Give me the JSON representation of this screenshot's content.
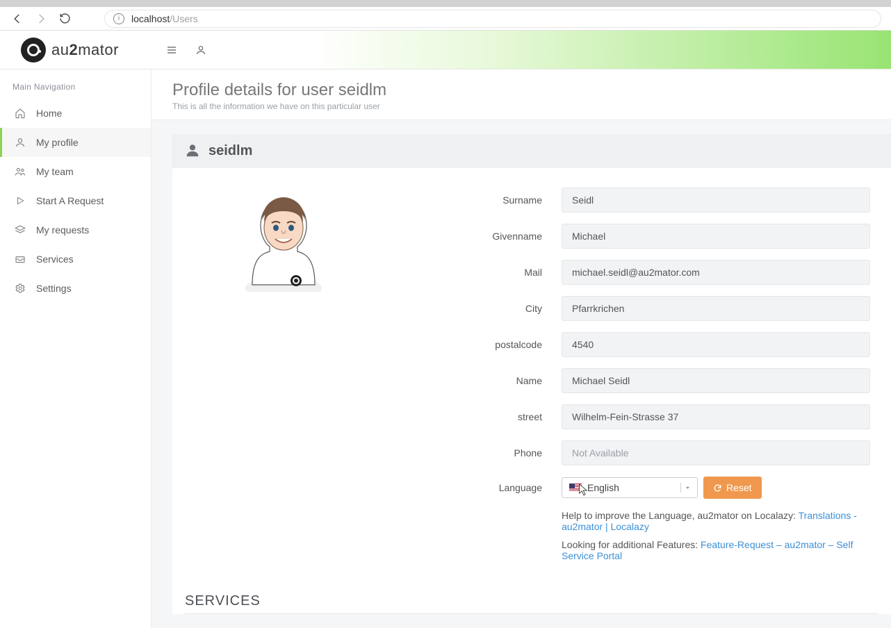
{
  "browser": {
    "url_host": "localhost",
    "url_path": "/Users"
  },
  "brand": {
    "pre": "au",
    "mid": "2",
    "post": "mator"
  },
  "sidebar": {
    "title": "Main Navigation",
    "items": [
      {
        "label": "Home"
      },
      {
        "label": "My profile"
      },
      {
        "label": "My team"
      },
      {
        "label": "Start A Request"
      },
      {
        "label": "My requests"
      },
      {
        "label": "Services"
      },
      {
        "label": "Settings"
      }
    ]
  },
  "page": {
    "title": "Profile details for user seidlm",
    "subtitle": "This is all the information we have on this particular user"
  },
  "profile": {
    "username": "seidlm",
    "fields": {
      "surname": {
        "label": "Surname",
        "value": "Seidl"
      },
      "givenname": {
        "label": "Givenname",
        "value": "Michael"
      },
      "mail": {
        "label": "Mail",
        "value": "michael.seidl@au2mator.com"
      },
      "city": {
        "label": "City",
        "value": "Pfarrkrichen"
      },
      "postalcode": {
        "label": "postalcode",
        "value": "4540"
      },
      "name": {
        "label": "Name",
        "value": "Michael Seidl"
      },
      "street": {
        "label": "street",
        "value": "Wilhelm-Fein-Strasse 37"
      },
      "phone": {
        "label": "Phone",
        "placeholder": "Not Available"
      },
      "language": {
        "label": "Language",
        "value": "English"
      }
    },
    "reset_label": "Reset",
    "help1_text": "Help to improve the Language, au2mator on Localazy: ",
    "help1_link": "Translations - au2mator | Localazy",
    "help2_text": "Looking for additional Features: ",
    "help2_link": "Feature-Request – au2mator – Self Service Portal"
  },
  "services_heading": "SERVICES"
}
